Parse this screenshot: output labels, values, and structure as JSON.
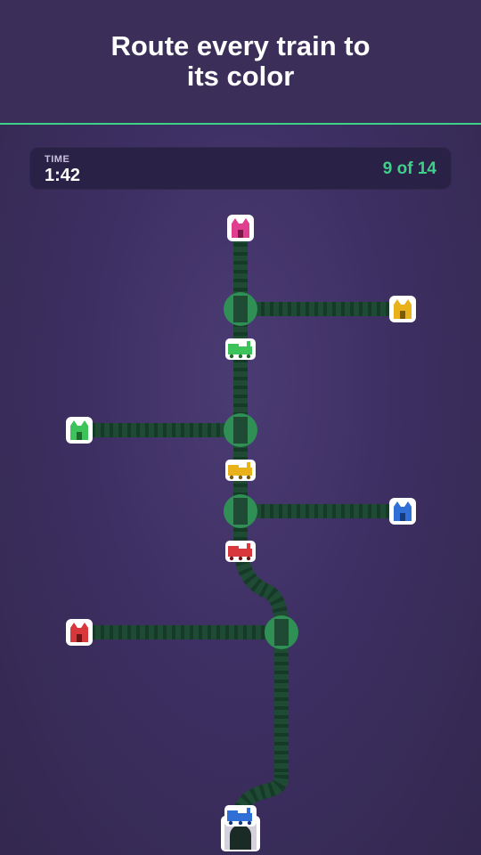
{
  "header": {
    "title": "Route every train to its color"
  },
  "hud": {
    "time_label": "TIME",
    "time_value": "1:42",
    "progress": "9 of 14"
  },
  "colors": {
    "accent": "#3fd08a",
    "track": "#1f4a34",
    "switch": "#2f8f55",
    "pink": "#e03e8e",
    "yellow": "#e9b21a",
    "green": "#3cc45a",
    "blue": "#2f6fd6",
    "red": "#d8373b"
  },
  "stations": [
    "pink-station",
    "yellow-station",
    "green-station",
    "blue-station",
    "red-station"
  ],
  "trains": [
    "green-train",
    "yellow-train",
    "red-train",
    "blue-train"
  ],
  "switches": 4
}
